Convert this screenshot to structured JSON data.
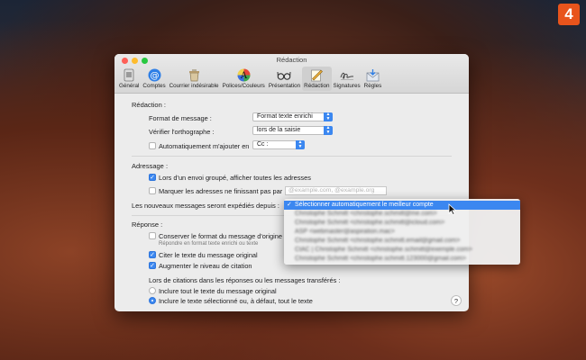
{
  "badge": "4",
  "window_title": "Rédaction",
  "toolbar": [
    {
      "label": "Général",
      "icon": "general-icon"
    },
    {
      "label": "Comptes",
      "icon": "at-sign-icon"
    },
    {
      "label": "Courrier indésirable",
      "icon": "junk-mail-icon"
    },
    {
      "label": "Polices/Couleurs",
      "icon": "fonts-colors-icon"
    },
    {
      "label": "Présentation",
      "icon": "glasses-icon"
    },
    {
      "label": "Rédaction",
      "icon": "compose-icon"
    },
    {
      "label": "Signatures",
      "icon": "signature-icon"
    },
    {
      "label": "Règles",
      "icon": "rules-icon"
    }
  ],
  "composing": {
    "header": "Rédaction :",
    "format_label": "Format de message :",
    "format_value": "Format texte enrichi",
    "spell_label": "Vérifier l'orthographe :",
    "spell_value": "lors de la saisie",
    "auto_add_label": "Automatiquement m'ajouter en",
    "auto_add_value": "Cc :"
  },
  "addressing": {
    "header": "Adressage :",
    "group_label": "Lors d'un envoi groupé, afficher toutes les adresses",
    "mark_label": "Marquer les adresses ne finissant pas par",
    "mark_placeholder": "@example.com, @example.org",
    "send_from_label": "Les nouveaux messages seront expédiés depuis :"
  },
  "replying": {
    "header": "Réponse :",
    "keep_format_label": "Conserver le format du message d'origine",
    "keep_format_hint": "Répondre en format texte enrichi ou texte",
    "quote_label": "Citer le texte du message original",
    "indent_label": "Augmenter le niveau de citation",
    "quoting_header": "Lors de citations dans les réponses ou les messages transférés :",
    "include_all_label": "Inclure tout le texte du message original",
    "include_selected_label": "Inclure le texte sélectionné ou, à défaut, tout le texte"
  },
  "help_label": "?",
  "dropdown": {
    "selected": "Sélectionner automatiquement le meilleur compte",
    "check": "✓",
    "blurred": [
      "Christophe Schmitt <christophe.schmitt@me.com>",
      "Christophe Schmitt <christophe.schmitt@icloud.com>",
      "ASP <webmaster@aspiration.mac>",
      "Christophe Schmitt <christophe.schmitt.email@gmail.com>",
      "CtAC | Christophe Schmitt <christophe.schmitt@exemple.com>",
      "Christophe Schmitt <christophe.schmitt.123000@gmail.com>"
    ]
  },
  "colors": {
    "accent": "#3b87f0",
    "close": "#fe5f57",
    "minimize": "#febc2e",
    "zoom": "#28c840",
    "badge": "#e8541c"
  }
}
